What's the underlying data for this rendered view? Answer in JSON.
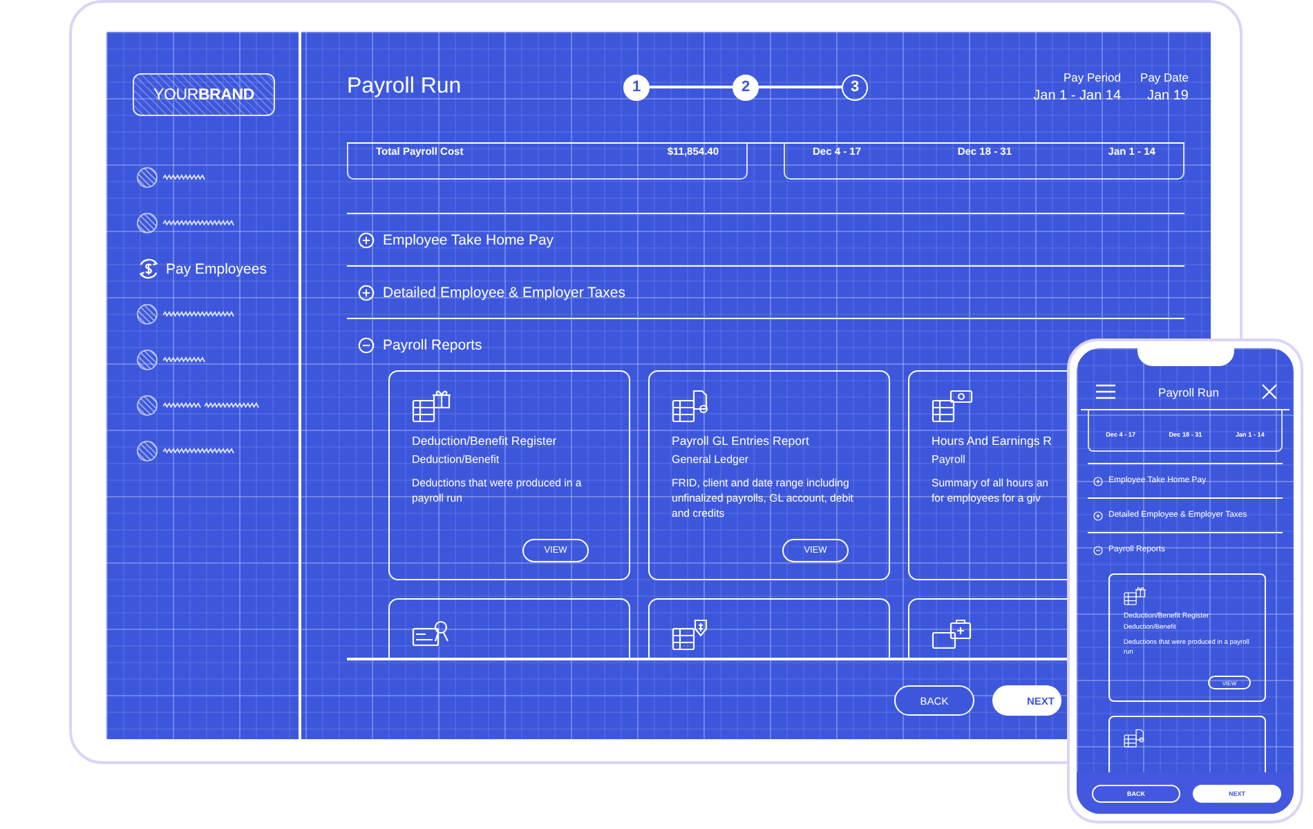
{
  "tablet": {
    "brand": "YOUR**BRAND**",
    "sidebar": {
      "items": [
        {
          "kind": "scribble-short",
          "selected": false
        },
        {
          "kind": "scribble-long",
          "selected": false
        },
        {
          "kind": "link",
          "label": "Pay Employees",
          "selected": true
        },
        {
          "kind": "scribble-long",
          "selected": false
        },
        {
          "kind": "scribble-short",
          "selected": false
        },
        {
          "kind": "scribble-pair",
          "selected": false
        },
        {
          "kind": "scribble-long",
          "selected": false
        }
      ]
    },
    "title": "Payroll Run",
    "steps": [
      {
        "label": "1",
        "done": true
      },
      {
        "label": "2",
        "done": true
      },
      {
        "label": "3",
        "done": false
      }
    ],
    "pay_info": [
      {
        "label": "Pay Period",
        "value": "Jan 1 - Jan 14"
      },
      {
        "label": "Pay Date",
        "value": "Jan 19"
      }
    ],
    "summary": {
      "total_label": "Total Payroll Cost",
      "total_value": "$11,854.40",
      "periods": [
        "Dec 4 - 17",
        "Dec 18 - 31",
        "Jan 1 - 14"
      ]
    },
    "sections": [
      {
        "label": "Employee Take Home Pay",
        "expanded": false
      },
      {
        "label": "Detailed Employee & Employer Taxes",
        "expanded": false
      },
      {
        "label": "Payroll Reports",
        "expanded": true,
        "reports": [
          {
            "kind": "gift",
            "title": "Deduction/Benefit Register",
            "category": "Deduction/Benefit",
            "description": "Deductions that were produced in a payroll run",
            "button": "VIEW"
          },
          {
            "kind": "document",
            "title": "Payroll GL Entries Report",
            "category": "General Ledger",
            "description": "FRID, client and date range including unfinalized payrolls, GL account, debit and credits",
            "button": "VIEW"
          },
          {
            "kind": "cash",
            "title": "Hours And Earnings R",
            "category": "Payroll",
            "description": "Summary of all hours an\nfor employees for a giv"
          },
          {
            "kind": "certificate"
          },
          {
            "kind": "dollar-tag"
          },
          {
            "kind": "medical"
          }
        ]
      }
    ],
    "buttons": {
      "back": "BACK",
      "next": "NEXT"
    }
  },
  "phone": {
    "title": "Payroll Run",
    "periods": [
      "Dec 4 - 17",
      "Dec 18 - 31",
      "Jan 1 - 14"
    ],
    "sections": [
      {
        "label": "Employee Take Home Pay",
        "expanded": false
      },
      {
        "label": "Detailed Employee & Employer Taxes",
        "expanded": false
      },
      {
        "label": "Payroll Reports",
        "expanded": true,
        "reports": [
          {
            "kind": "gift",
            "title": "Deduction/Benefit Register",
            "category": "Deduction/Benefit",
            "description": "Deductions that were produced in a payroll run",
            "button": "VIEW"
          },
          {
            "kind": "document"
          }
        ]
      }
    ],
    "buttons": {
      "back": "BACK",
      "next": "NEXT"
    }
  }
}
